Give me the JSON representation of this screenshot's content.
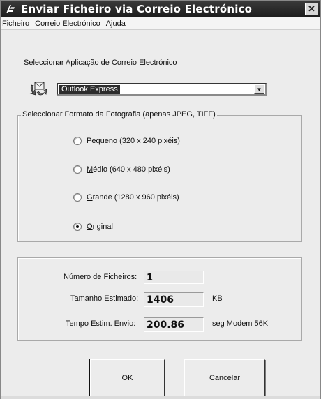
{
  "window": {
    "title": "Enviar Ficheiro via Correio Electrónico",
    "close_glyph": "✕"
  },
  "menu": [
    {
      "label": "Ficheiro",
      "mnemonic_first": "F",
      "rest": "icheiro"
    },
    {
      "label": "Correio Electrónico",
      "pre": "Correio ",
      "mnemonic": "E",
      "post": "lectrónico"
    },
    {
      "label": "Ajuda"
    }
  ],
  "app_section": {
    "label": "Seleccionar Aplicação de Correio Electrónico",
    "icon": "mail-app-icon",
    "selected_app": "Outlook Express"
  },
  "format_section": {
    "title": "Seleccionar Formato da Fotografia (apenas JPEG, TIFF)",
    "options": [
      {
        "mnemonic": "P",
        "rest": "equeno (320 x 240 pixéis)",
        "checked": false
      },
      {
        "mnemonic": "M",
        "rest": "édio (640 x 480 pixéis)",
        "checked": false
      },
      {
        "mnemonic": "G",
        "rest": "rande (1280 x 960 pixéis)",
        "checked": false
      },
      {
        "mnemonic": "O",
        "rest": "riginal",
        "checked": true
      }
    ]
  },
  "info": {
    "files_label": "Número de Ficheiros:",
    "files_value": "1",
    "size_label": "Tamanho Estimado:",
    "size_value": "1406",
    "size_unit": "KB",
    "time_label": "Tempo Estim. Envio:",
    "time_value": "200.86",
    "time_unit": "seg Modem 56K"
  },
  "buttons": {
    "ok": "OK",
    "cancel": "Cancelar"
  },
  "colors": {
    "titlebar": "#1c1c1c",
    "window_bg": "#ececec",
    "selection": "#2c2c2c"
  }
}
